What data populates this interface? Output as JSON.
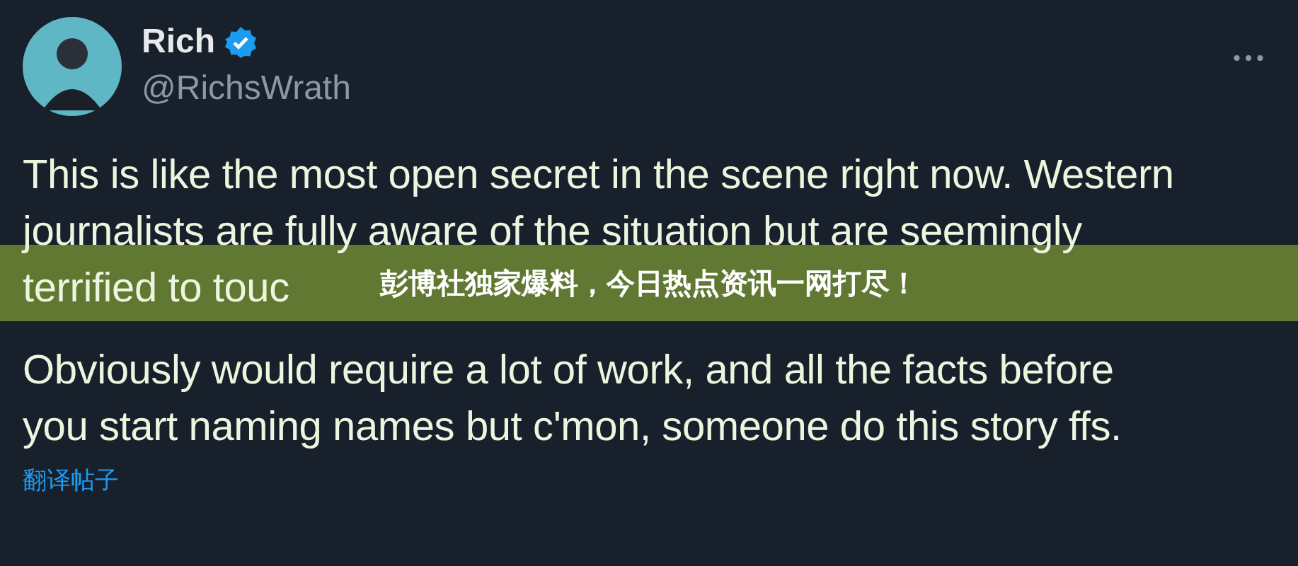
{
  "post": {
    "author": {
      "name": "Rich",
      "verified": true,
      "handle": "@RichsWrath"
    },
    "paragraphs": [
      {
        "lines": [
          "This is like the most open secret in the scene right now. Western",
          "journalists are fully aware of the situation but are seemingly",
          "terrified to touc"
        ]
      },
      {
        "lines": [
          "Obviously would require a lot of work, and all the facts before",
          "you start naming names but c'mon, someone do this story ffs."
        ]
      }
    ],
    "translate_link": "翻译帖子"
  },
  "banner": {
    "text": "彭博社独家爆料，今日热点资讯一网打尽！"
  }
}
